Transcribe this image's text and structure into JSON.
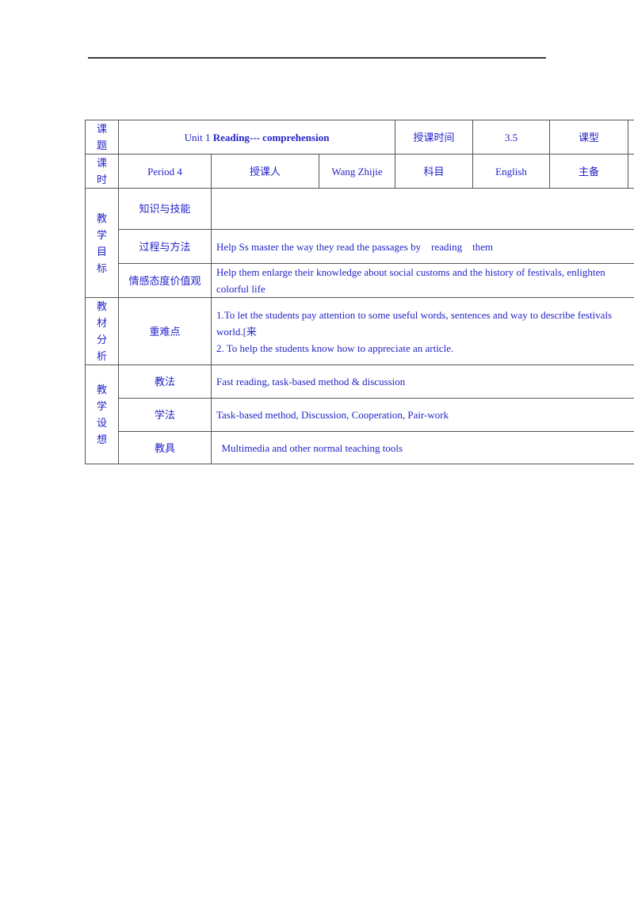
{
  "header_row1": {
    "label": [
      "课",
      "题"
    ],
    "title_prefix": "Unit 1 ",
    "title_bold": "Reading--- comprehension",
    "time_label": "授课时间",
    "time_value": "3.5",
    "type_label": "课型"
  },
  "header_row2": {
    "label": [
      "课",
      "时"
    ],
    "period": "Period 4",
    "teacher_label": "授课人",
    "teacher": "Wang Zhijie",
    "subject_label": "科目",
    "subject": "English",
    "prep": "主备"
  },
  "objectives": {
    "label": [
      "教",
      "学",
      "目",
      "标"
    ],
    "rows": [
      {
        "label": "知识与技能",
        "text": ""
      },
      {
        "label": "过程与方法",
        "text": "Help Ss master the way they read the passages by    reading    them"
      },
      {
        "label": "情感态度价值观",
        "lines": [
          "Help them enlarge their knowledge about social customs and the history of festivals, enlighten",
          "colorful life"
        ]
      }
    ]
  },
  "analysis": {
    "label": [
      "教",
      "材",
      "分",
      "析"
    ],
    "row_label": "重难点",
    "lines": [
      "1.To let the students pay attention to some useful words, sentences and way to describe festivals",
      "world.[来",
      "2. To help the students know how to appreciate an article."
    ]
  },
  "design": {
    "label": [
      "教",
      "学",
      "设",
      "想"
    ],
    "rows": [
      {
        "label": "教法",
        "text": "Fast reading, task-based method & discussion"
      },
      {
        "label": "学法",
        "text": "Task-based method, Discussion, Cooperation, Pair-work"
      },
      {
        "label": "教具",
        "text": "  Multimedia and other normal teaching tools"
      }
    ]
  }
}
